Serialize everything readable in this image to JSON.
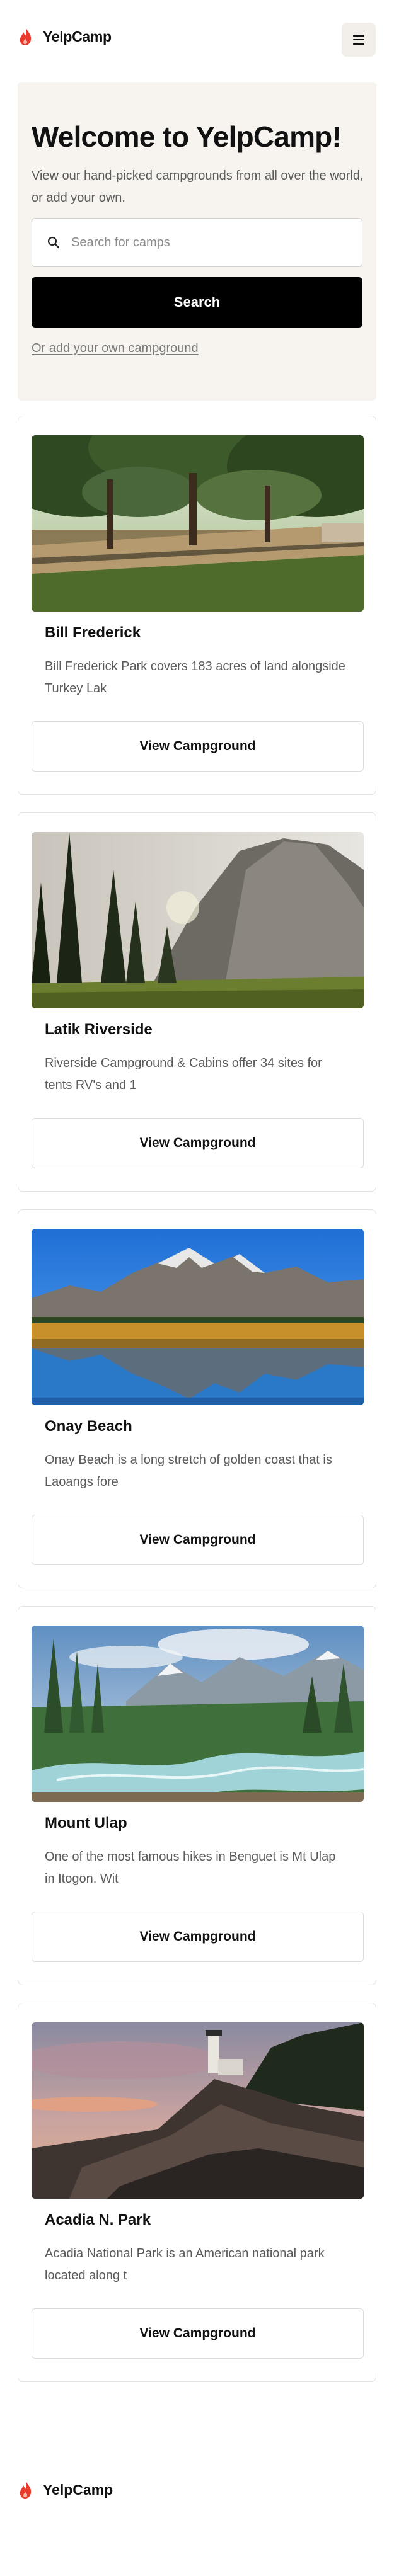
{
  "header": {
    "brand_name": "YelpCamp",
    "brand_icon": "flame-icon",
    "menu_icon": "hamburger-icon"
  },
  "hero": {
    "title": "Welcome to YelpCamp!",
    "description": "View our hand-picked campgrounds from all over the world, or add your own.",
    "search_placeholder": "Search for camps",
    "search_value": "",
    "search_button_label": "Search",
    "add_link_label": "Or add your own campground"
  },
  "campgrounds": [
    {
      "title": "Bill Frederick",
      "description": "Bill Frederick Park covers 183 acres of land alongside Turkey Lak",
      "button_label": "View Campground"
    },
    {
      "title": "Latik Riverside",
      "description": "Riverside Campground & Cabins offer 34 sites for tents RV's and 1",
      "button_label": "View Campground"
    },
    {
      "title": "Onay Beach",
      "description": "Onay Beach is a long stretch of golden coast that is Laoangs fore",
      "button_label": "View Campground"
    },
    {
      "title": "Mount Ulap",
      "description": "One of the most famous hikes in Benguet is Mt Ulap in Itogon. Wit",
      "button_label": "View Campground"
    },
    {
      "title": "Acadia N. Park",
      "description": "Acadia National Park is an American national park located along t",
      "button_label": "View Campground"
    }
  ],
  "footer": {
    "brand_name": "YelpCamp"
  },
  "colors": {
    "brand_flame": "#e8392b",
    "hero_bg": "#f7f4ef",
    "primary_button": "#000000"
  }
}
